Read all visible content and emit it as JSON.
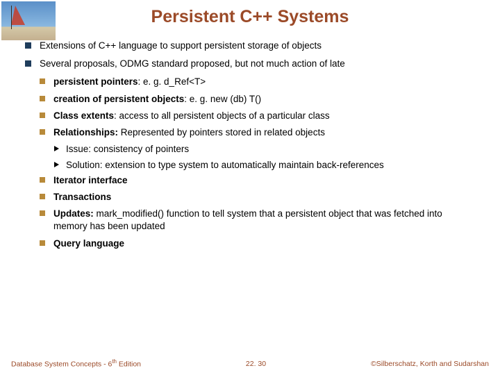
{
  "title": "Persistent C++ Systems",
  "bullets_l1": [
    "Extensions of C++ language to support persistent storage of objects",
    "Several proposals, ODMG standard proposed, but not much action of late"
  ],
  "bullets_l2a": {
    "b0_bold": "persistent pointers",
    "b0_rest": ": e. g. d_Ref<T>",
    "b1_bold": "creation of persistent objects",
    "b1_rest": ": e. g. new (db) T()",
    "b2_bold": "Class extents",
    "b2_rest": ": access to all persistent objects of a particular class",
    "b3_bold": "Relationships:",
    "b3_rest": " Represented by pointers stored in related objects"
  },
  "bullets_l3": {
    "b0": "Issue: consistency of pointers",
    "b1": "Solution: extension to type system to automatically maintain back-references"
  },
  "bullets_l2b": {
    "b0_bold": "Iterator interface",
    "b1_bold": "Transactions",
    "b2_bold": "Updates:",
    "b2_rest": " mark_modified() function to tell system that a persistent object that was fetched into memory has been updated",
    "b3_bold": "Query language"
  },
  "footer": {
    "left_a": "Database System Concepts - 6",
    "left_b": "th",
    "left_c": " Edition",
    "center": "22. 30",
    "right": "©Silberschatz, Korth and Sudarshan"
  }
}
